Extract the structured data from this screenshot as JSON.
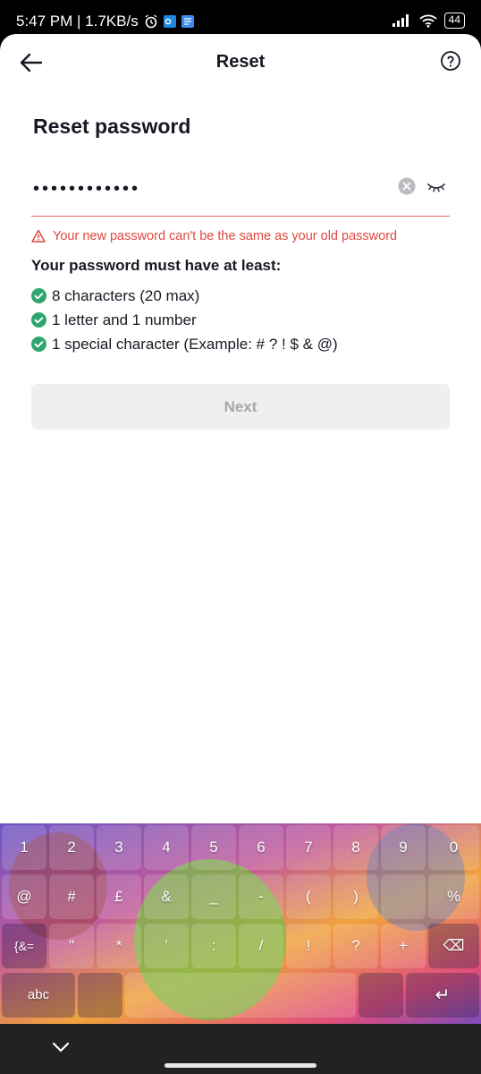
{
  "status_bar": {
    "time_speed": "5:47 PM | 1.7KB/s",
    "battery": "44"
  },
  "nav": {
    "title": "Reset",
    "back_icon": "arrow-left-icon",
    "help_icon": "question-circle-icon"
  },
  "page": {
    "title": "Reset password"
  },
  "password_field": {
    "value": "••••••••••••",
    "clear_icon": "clear-circle-icon",
    "visibility_icon": "eye-closed-icon"
  },
  "error": {
    "message": "Your new password can't be the same as your old password",
    "color": "#e0483e"
  },
  "requirements": {
    "heading": "Your password must have at least:",
    "items": [
      {
        "label": "8 characters (20 max)"
      },
      {
        "label": "1 letter and 1 number"
      },
      {
        "label": "1 special character (Example: # ? ! $ & @)"
      }
    ],
    "check_color": "#2fa66d"
  },
  "next_button": {
    "label": "Next"
  },
  "keyboard": {
    "row1": [
      "1",
      "2",
      "3",
      "4",
      "5",
      "6",
      "7",
      "8",
      "9",
      "0"
    ],
    "row2": [
      "@",
      "#",
      "£",
      "&",
      "_",
      "-",
      "(",
      ")",
      "",
      "%"
    ],
    "row3": [
      "{&=",
      "\"",
      "*",
      "'",
      ":",
      "/",
      "!",
      "?",
      "+",
      "⌫"
    ],
    "row4": [
      "abc",
      "",
      "",
      "↵"
    ]
  }
}
